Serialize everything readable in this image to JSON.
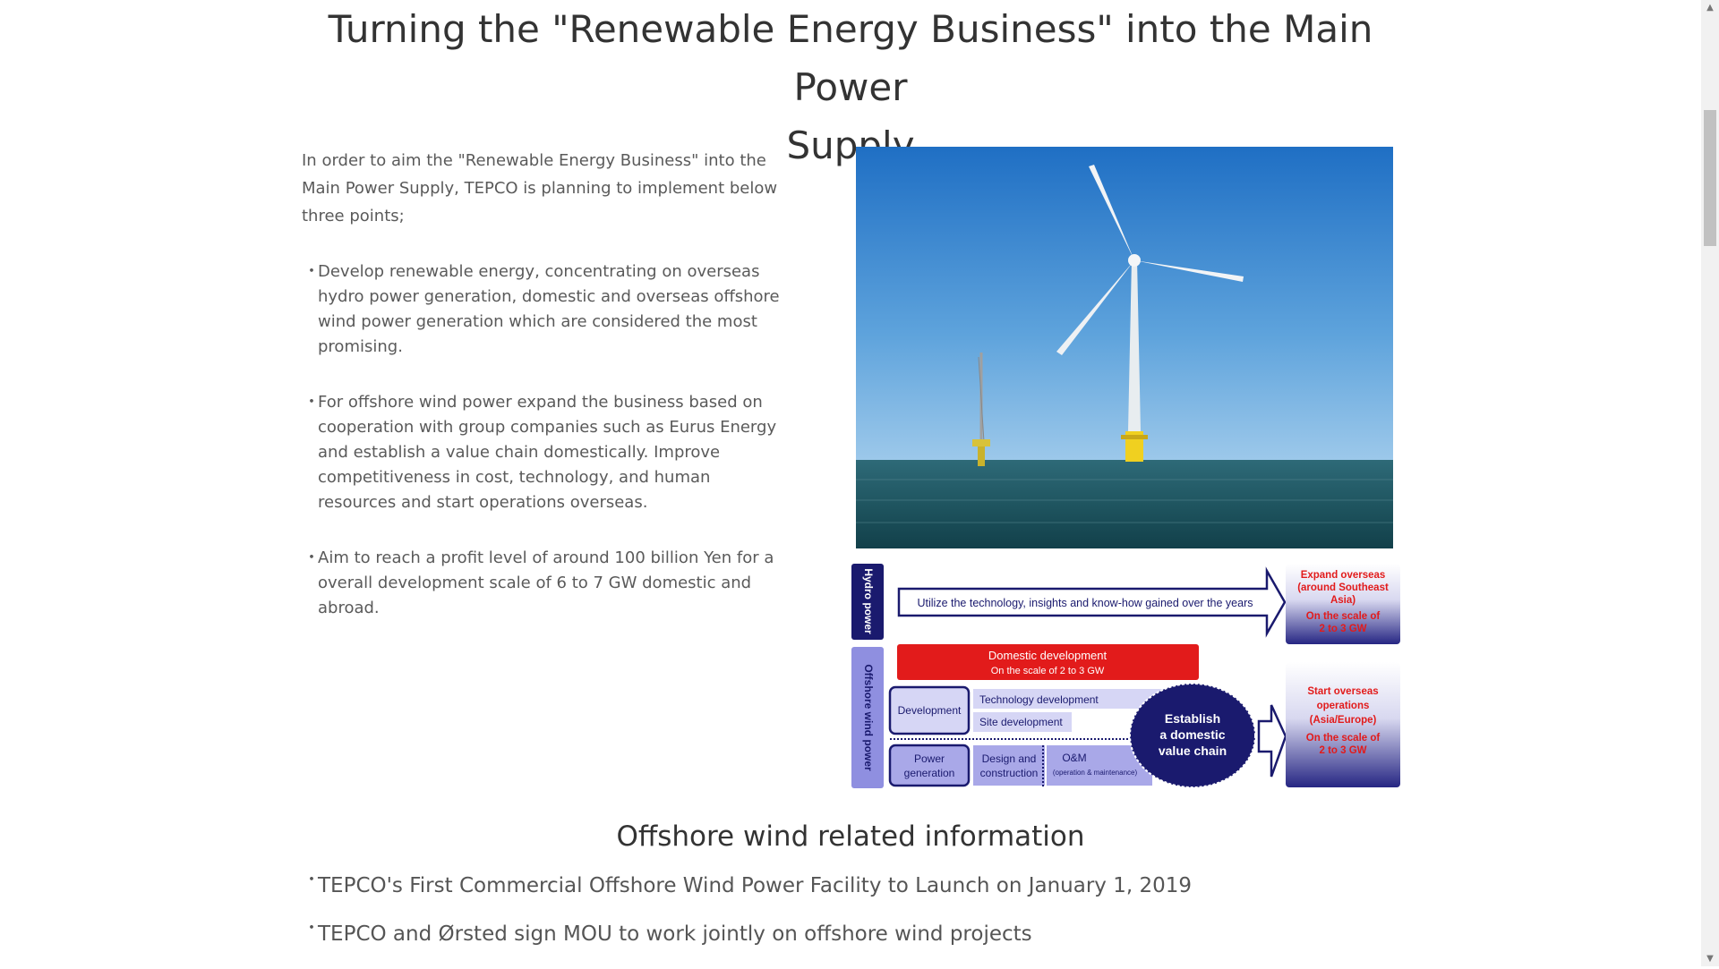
{
  "page": {
    "title_line1": "Turning the \"Renewable Energy Business\" into the Main Power",
    "title_line2": "Supply"
  },
  "intro": "In order to aim the \"Renewable Energy Business\" into the Main Power Supply, TEPCO is planning to implement below three points;",
  "bullet_marker": "・",
  "bullets": [
    "Develop renewable energy, concentrating on overseas hydro power generation, domestic and overseas offshore wind power generation which are considered the most promising.",
    "For offshore wind power expand the business based on cooperation with group companies such as Eurus Energy and establish a value chain domestically. Improve competitiveness in cost, technology, and human resources and start operations overseas.",
    "Aim to reach a profit level of around 100 billion Yen for a overall development scale of 6 to 7 GW domestic and abroad."
  ],
  "diagram": {
    "hydro_label": "Hydro power",
    "offshore_label": "Offshore wind power",
    "utilize_text": "Utilize the technology, insights and know-how gained over the years",
    "expand_l1": "Expand overseas",
    "expand_l2": "(around Southeast",
    "expand_l3": "Asia)",
    "expand_scale1": "On the scale of",
    "expand_scale2": "2 to 3 GW",
    "domestic_l1": "Domestic development",
    "domestic_l2": "On the scale of 2 to 3 GW",
    "development": "Development",
    "tech_dev": "Technology development",
    "site_dev": "Site development",
    "power_gen1": "Power",
    "power_gen2": "generation",
    "design1": "Design and",
    "design2": "construction",
    "om": "O&M",
    "om_sub": "(operation & maintenance)",
    "establish1": "Establish",
    "establish2": "a domestic",
    "establish3": "value chain",
    "start_l1": "Start overseas",
    "start_l2": "operations",
    "start_l3": "(Asia/Europe)",
    "start_scale1": "On the scale of",
    "start_scale2": "2 to 3 GW"
  },
  "subheading": "Offshore wind related information",
  "links": [
    "TEPCO's First Commercial Offshore Wind Power Facility to Launch on January 1, 2019",
    "TEPCO and Ørsted sign MOU to work jointly on offshore wind projects"
  ],
  "colors": {
    "navy": "#1a1a6e",
    "red": "#e21b1b",
    "lavender": "#a9a8e8",
    "light_lavender": "#d6d6f5"
  },
  "scrollbar": {
    "up_icon": "▲",
    "down_icon": "▼"
  }
}
